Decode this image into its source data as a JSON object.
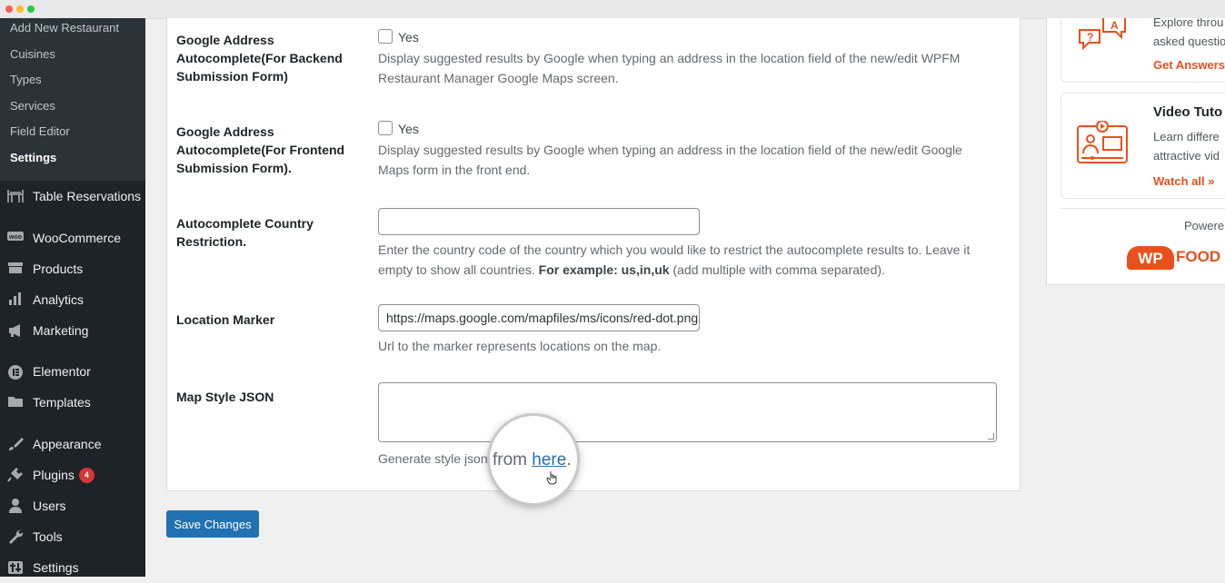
{
  "sidebar": {
    "submenu": [
      "Add New Restaurant",
      "Cuisines",
      "Types",
      "Services",
      "Field Editor",
      "Settings"
    ],
    "menu": [
      {
        "label": "Table Reservations",
        "icon": "table-icon"
      },
      {
        "label": "WooCommerce",
        "icon": "woocommerce-icon"
      },
      {
        "label": "Products",
        "icon": "products-icon"
      },
      {
        "label": "Analytics",
        "icon": "analytics-icon"
      },
      {
        "label": "Marketing",
        "icon": "megaphone-icon"
      },
      {
        "label": "Elementor",
        "icon": "elementor-icon"
      },
      {
        "label": "Templates",
        "icon": "folder-icon"
      },
      {
        "label": "Appearance",
        "icon": "paintbrush-icon"
      },
      {
        "label": "Plugins",
        "icon": "plugin-icon",
        "badge": "4"
      },
      {
        "label": "Users",
        "icon": "users-icon"
      },
      {
        "label": "Tools",
        "icon": "wrench-icon"
      },
      {
        "label": "Settings",
        "icon": "settings-icon"
      }
    ]
  },
  "form": {
    "backend": {
      "label": "Google Address Autocomplete(For Backend Submission Form)",
      "checkbox_label": "Yes",
      "checked": false,
      "description": "Display suggested results by Google when typing an address in the location field of the new/edit WPFM Restaurant Manager Google Maps screen."
    },
    "frontend": {
      "label": "Google Address Autocomplete(For Frontend Submission Form).",
      "checkbox_label": "Yes",
      "checked": false,
      "description": "Display suggested results by Google when typing an address in the location field of the new/edit Google Maps form in the front end."
    },
    "country": {
      "label": "Autocomplete Country Restriction.",
      "value": "",
      "description": "Enter the country code of the country which you would like to restrict the autocomplete results to. Leave it empty to show all countries.",
      "example_label": "For example:",
      "example_value": "us,in,uk",
      "example_note": "(add multiple with comma separated)."
    },
    "marker": {
      "label": "Location Marker",
      "value": "https://maps.google.com/mapfiles/ms/icons/red-dot.png",
      "description": "Url to the marker represents locations on the map."
    },
    "map_style": {
      "label": "Map Style JSON",
      "value": "",
      "description_prefix": "Generate style json",
      "magnified_prefix": "from",
      "link_text": "here",
      "suffix": "."
    }
  },
  "save_button": "Save Changes",
  "right_panel": {
    "faq": {
      "title": "",
      "text1": "Explore throu",
      "text2": "asked questio",
      "link": "Get Answers"
    },
    "video": {
      "title": "Video Tuto",
      "text1": "Learn differe",
      "text2": "attractive vid",
      "link": "Watch all »"
    },
    "powered_by": "Powere",
    "logo": {
      "wp": "WP",
      "food": "FOOD"
    }
  },
  "colors": {
    "sidebar_bg": "#1d2327",
    "accent": "#2271b1",
    "brand": "#e8501c"
  }
}
